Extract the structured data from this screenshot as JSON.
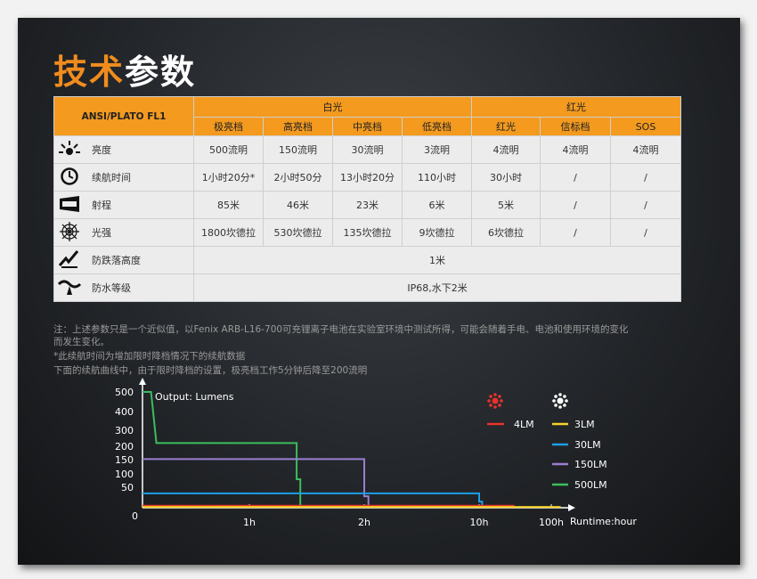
{
  "title": {
    "part1": "技术",
    "part2": "参数"
  },
  "table": {
    "corner": "ANSI/PLATO FL1",
    "group_white": "白光",
    "group_red": "红光",
    "columns": [
      "极亮档",
      "高亮档",
      "中亮档",
      "低亮档",
      "红光",
      "信标档",
      "SOS"
    ],
    "rows": [
      {
        "icon": "brightness-icon",
        "label": "亮度",
        "cells": [
          "500流明",
          "150流明",
          "30流明",
          "3流明",
          "4流明",
          "4流明",
          "4流明"
        ]
      },
      {
        "icon": "clock-icon",
        "label": "续航时间",
        "cells": [
          "1小时20分*",
          "2小时50分",
          "13小时20分",
          "110小时",
          "30小时",
          "/",
          "/"
        ]
      },
      {
        "icon": "beam-distance-icon",
        "label": "射程",
        "cells": [
          "85米",
          "46米",
          "23米",
          "6米",
          "5米",
          "/",
          "/"
        ]
      },
      {
        "icon": "intensity-icon",
        "label": "光强",
        "cells": [
          "1800坎德拉",
          "530坎德拉",
          "135坎德拉",
          "9坎德拉",
          "6坎德拉",
          "/",
          "/"
        ]
      }
    ],
    "impact": {
      "icon": "impact-resistance-icon",
      "label": "防跌落高度",
      "value": "1米"
    },
    "water": {
      "icon": "waterproof-icon",
      "label": "防水等级",
      "value": "IP68,水下2米"
    }
  },
  "notes": [
    "注：上述参数只是一个近似值，以Fenix ARB-L16-700可充锂离子电池在实验室环境中测试所得，可能会随着手电、电池和使用环境的变化",
    "而发生变化。",
    "*此续航时间为增加限时降档情况下的续航数据",
    "下面的续航曲线中，由于限时降档的设置，极亮档工作5分钟后降至200流明"
  ],
  "chart_data": {
    "type": "line",
    "ylabel": "Output: Lumens",
    "xlabel": "Runtime:hour",
    "y_ticks": [
      "500",
      "400",
      "300",
      "200",
      "150",
      "100",
      "50",
      "0"
    ],
    "x_ticks": [
      "1h",
      "2h",
      "10h",
      "100h"
    ],
    "legend": {
      "red_icon": "red-light-icon",
      "white_icon": "white-light-icon",
      "red_items": [
        {
          "name": "4LM",
          "color": "#e8322c"
        }
      ],
      "white_items": [
        {
          "name": "3LM",
          "color": "#f5d327"
        },
        {
          "name": "30LM",
          "color": "#1d9ee8"
        },
        {
          "name": "150LM",
          "color": "#9b7fd0"
        },
        {
          "name": "500LM",
          "color": "#3bbd5e"
        }
      ]
    },
    "series": [
      {
        "name": "500LM",
        "color": "#3bbd5e",
        "points": [
          [
            0,
            500
          ],
          [
            0.08,
            500
          ],
          [
            0.13,
            220
          ],
          [
            1.33,
            220
          ],
          [
            1.33,
            80
          ],
          [
            1.36,
            80
          ],
          [
            1.36,
            0
          ]
        ]
      },
      {
        "name": "150LM",
        "color": "#9b7fd0",
        "points": [
          [
            0,
            152
          ],
          [
            2.0,
            152
          ],
          [
            2.0,
            28
          ],
          [
            2.12,
            28
          ],
          [
            2.12,
            0
          ]
        ]
      },
      {
        "name": "30LM",
        "color": "#1d9ee8",
        "points": [
          [
            0,
            35
          ],
          [
            10.0,
            35
          ],
          [
            10.0,
            15
          ],
          [
            11,
            15
          ],
          [
            11,
            0
          ]
        ]
      },
      {
        "name": "4LM",
        "color": "#e8322c",
        "points": [
          [
            0,
            5
          ],
          [
            30,
            5
          ],
          [
            30,
            0
          ]
        ]
      },
      {
        "name": "3LM",
        "color": "#f5d327",
        "points": [
          [
            0,
            2
          ],
          [
            110,
            2
          ],
          [
            110,
            0
          ]
        ]
      }
    ]
  }
}
